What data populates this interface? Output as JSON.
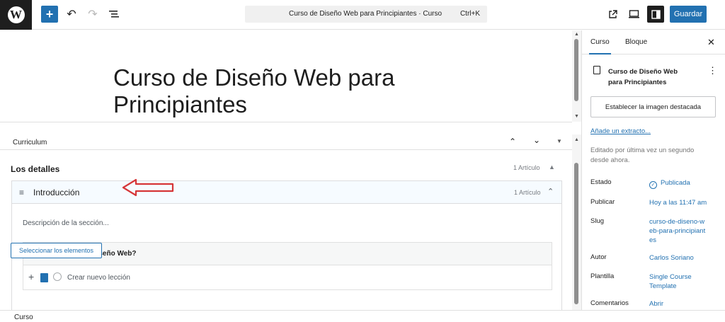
{
  "topbar": {
    "logo_glyph": "W",
    "command_title": "Curso de Diseño Web para Principiantes · Curso",
    "command_shortcut": "Ctrl+K",
    "save_label": "Guardar",
    "icons": [
      "wordpress-logo-icon",
      "plus-icon",
      "undo-icon",
      "redo-icon",
      "document-overview-icon",
      "external-view-icon",
      "preview-icon",
      "sidebar-settings-icon"
    ]
  },
  "editor": {
    "post_title": "Curso de Diseño Web para Principiantes"
  },
  "metabox": {
    "panel_title": "Curriculum",
    "details_label": "Los detalles",
    "details_count": "1 Artículo",
    "section": {
      "name": "Introducción",
      "count": "1 Artículo",
      "description_placeholder": "Descripción de la sección...",
      "lessons": [
        {
          "title": "¿Qué es el Diseño Web?"
        }
      ],
      "new_lesson_placeholder": "Crear nuevo lección"
    },
    "select_button": "Seleccionar los elementos"
  },
  "footer": {
    "breadcrumb": "Curso"
  },
  "sidebar": {
    "tabs": [
      "Curso",
      "Bloque"
    ],
    "active_tab": "Curso",
    "post_title": "Curso de Diseño Web para Principiantes",
    "featured_image_button": "Establecer la imagen destacada",
    "excerpt_link": "Añade un extracto...",
    "last_edited": "Editado por última vez un segundo desde ahora.",
    "rows": [
      {
        "label": "Estado",
        "value": "Publicada"
      },
      {
        "label": "Publicar",
        "value": "Hoy a las 11:47 am"
      },
      {
        "label": "Slug",
        "value": "curso-de-diseno-web-para-principiantes"
      },
      {
        "label": "Autor",
        "value": "Carlos Soriano"
      },
      {
        "label": "Plantilla",
        "value": "Single Course Template"
      },
      {
        "label": "Comentarios",
        "value": "Abrir"
      }
    ]
  },
  "colors": {
    "accent": "#2271b1",
    "annotation_arrow": "#d63638",
    "dark": "#1e1e1e"
  }
}
